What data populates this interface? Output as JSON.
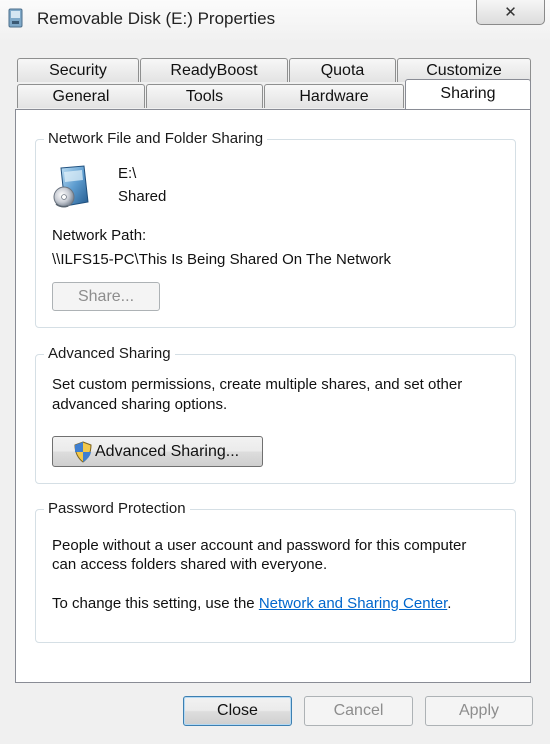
{
  "window": {
    "title": "Removable Disk (E:) Properties",
    "close_glyph": "✕"
  },
  "tabs": {
    "row_back": [
      "Security",
      "ReadyBoost",
      "Quota",
      "Customize"
    ],
    "row_front": [
      "General",
      "Tools",
      "Hardware",
      "Sharing"
    ],
    "active": "Sharing"
  },
  "network_sharing": {
    "title": "Network File and Folder Sharing",
    "icon": "shared-drive-icon",
    "drive": "E:\\",
    "status": "Shared",
    "path_label": "Network Path:",
    "path_value": "\\\\ILFS15-PC\\This Is Being Shared On The Network",
    "share_button": "Share..."
  },
  "advanced_sharing": {
    "title": "Advanced Sharing",
    "description_line1": "Set custom permissions, create multiple shares, and set other",
    "description_line2": "advanced sharing options.",
    "button_icon": "uac-shield-icon",
    "button_label": "Advanced Sharing..."
  },
  "password_protection": {
    "title": "Password Protection",
    "line1": "People without a user account and password for this computer",
    "line2": "can access folders shared with everyone.",
    "change_prefix": "To change this setting, use the ",
    "link": "Network and Sharing Center",
    "change_suffix": "."
  },
  "footer": {
    "close": "Close",
    "cancel": "Cancel",
    "apply": "Apply"
  },
  "colors": {
    "link": "#0066cc",
    "dialog_background": "#f0f0f0",
    "panel_background": "#ffffff"
  }
}
